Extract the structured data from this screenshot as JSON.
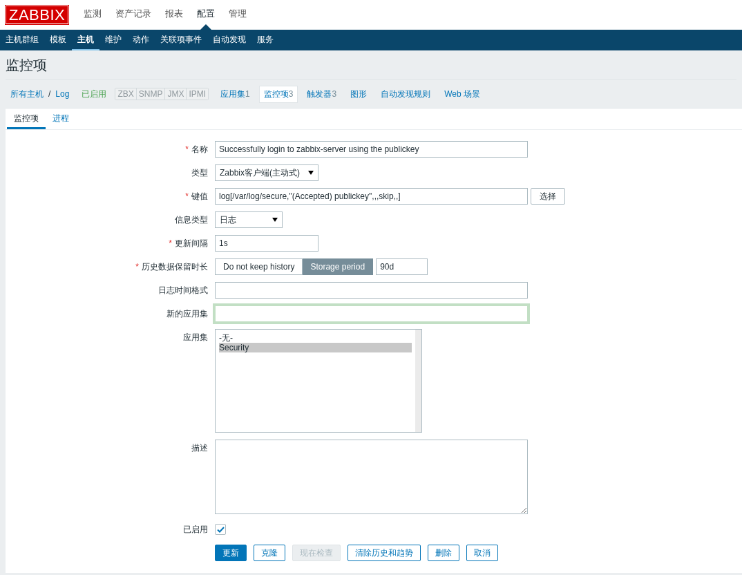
{
  "logo": "ZABBIX",
  "top_menu": [
    {
      "label": "监测",
      "selected": false
    },
    {
      "label": "资产记录",
      "selected": false
    },
    {
      "label": "报表",
      "selected": false
    },
    {
      "label": "配置",
      "selected": true
    },
    {
      "label": "管理",
      "selected": false
    }
  ],
  "sub_menu": [
    {
      "label": "主机群组",
      "selected": false
    },
    {
      "label": "模板",
      "selected": false
    },
    {
      "label": "主机",
      "selected": true
    },
    {
      "label": "维护",
      "selected": false
    },
    {
      "label": "动作",
      "selected": false
    },
    {
      "label": "关联项事件",
      "selected": false
    },
    {
      "label": "自动发现",
      "selected": false
    },
    {
      "label": "服务",
      "selected": false
    }
  ],
  "page_title": "监控项",
  "breadcrumb": {
    "links": [
      "所有主机",
      "Log"
    ],
    "separator": "/"
  },
  "host_status": "已启用",
  "interfaces": [
    {
      "label": "ZBX",
      "available": false
    },
    {
      "label": "SNMP",
      "available": false
    },
    {
      "label": "JMX",
      "available": false
    },
    {
      "label": "IPMI",
      "available": false
    }
  ],
  "host_tabs": [
    {
      "label": "应用集",
      "count": "1",
      "selected": false
    },
    {
      "label": "监控项",
      "count": "3",
      "selected": true
    },
    {
      "label": "触发器",
      "count": "3",
      "selected": false
    },
    {
      "label": "图形",
      "selected": false
    },
    {
      "label": "自动发现规则",
      "selected": false
    },
    {
      "label": "Web 场景",
      "selected": false
    }
  ],
  "required_mark": "*",
  "form_tabs": [
    {
      "label": "监控项",
      "selected": true
    },
    {
      "label": "进程",
      "selected": false
    }
  ],
  "fields": [
    {
      "kind": "text",
      "label": "名称",
      "required": true,
      "focused": false,
      "value": "Successfully login to zabbix-server using the publickey"
    },
    {
      "kind": "select",
      "label": "类型",
      "required": false,
      "value": "Zabbix客户端(主动式)"
    },
    {
      "kind": "text_button",
      "label": "键值",
      "required": true,
      "value": "log[/var/log/secure,\"(Accepted) publickey\",,,skip,,]",
      "button": "选择"
    },
    {
      "kind": "select",
      "label": "信息类型",
      "required": false,
      "value": "日志"
    },
    {
      "kind": "short_text",
      "label": "更新间隔",
      "required": true,
      "value": "1s"
    },
    {
      "kind": "toggle_text",
      "label": "历史数据保留时长",
      "required": true,
      "options": [
        {
          "label": "Do not keep history",
          "selected": false
        },
        {
          "label": "Storage period",
          "selected": true
        }
      ],
      "value": "90d"
    },
    {
      "kind": "text",
      "label": "日志时间格式",
      "required": false,
      "focused": false
    },
    {
      "kind": "text",
      "label": "新的应用集",
      "required": false,
      "focused": true
    },
    {
      "kind": "listbox",
      "label": "应用集",
      "required": false,
      "options": [
        {
          "label": "-无-",
          "selected": false
        },
        {
          "label": "Security",
          "selected": true
        }
      ]
    },
    {
      "kind": "textarea",
      "label": "描述",
      "required": false
    },
    {
      "kind": "checkbox",
      "label": "已启用",
      "required": false,
      "checked": true
    }
  ],
  "buttons": [
    {
      "label": "更新",
      "kind": "primary"
    },
    {
      "label": "克隆",
      "kind": "normal"
    },
    {
      "label": "现在检查",
      "kind": "disabled"
    },
    {
      "label": "清除历史和趋势",
      "kind": "normal"
    },
    {
      "label": "删除",
      "kind": "normal"
    },
    {
      "label": "取消",
      "kind": "normal"
    }
  ]
}
